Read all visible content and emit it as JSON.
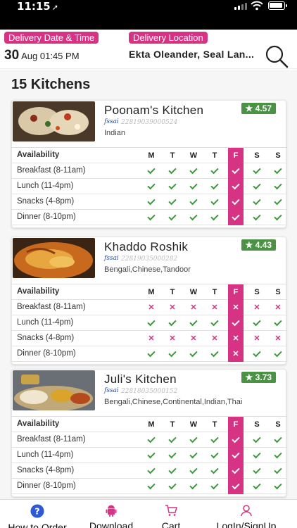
{
  "status": {
    "time": "11:15"
  },
  "header": {
    "date_chip": "Delivery Date & Time",
    "location_chip": "Delivery Location",
    "date_day": "30",
    "date_rest": "Aug 01:45 PM",
    "location": "Ekta Oleander, Seal Lan..."
  },
  "list": {
    "title": "15 Kitchens",
    "days": [
      "M",
      "T",
      "W",
      "T",
      "F",
      "S",
      "S"
    ],
    "today_index": 4,
    "availability_label": "Availability",
    "kitchens": [
      {
        "name": "Poonam's Kitchen",
        "rating": "4.57",
        "fssai_logo": "fssai",
        "fssai_no": "22819039000524",
        "cuisine": "Indian",
        "meals": [
          {
            "label": "Breakfast (8-11am)",
            "avail": [
              1,
              1,
              1,
              1,
              1,
              1,
              1
            ]
          },
          {
            "label": "Lunch (11-4pm)",
            "avail": [
              1,
              1,
              1,
              1,
              1,
              1,
              1
            ]
          },
          {
            "label": "Snacks (4-8pm)",
            "avail": [
              1,
              1,
              1,
              1,
              1,
              1,
              1
            ]
          },
          {
            "label": "Dinner (8-10pm)",
            "avail": [
              1,
              1,
              1,
              1,
              1,
              1,
              1
            ]
          }
        ]
      },
      {
        "name": "Khaddo Roshik",
        "rating": "4.43",
        "fssai_logo": "fssai",
        "fssai_no": "22819035000282",
        "cuisine": "Bengali,Chinese,Tandoor",
        "meals": [
          {
            "label": "Breakfast (8-11am)",
            "avail": [
              0,
              0,
              0,
              0,
              0,
              0,
              0
            ]
          },
          {
            "label": "Lunch (11-4pm)",
            "avail": [
              1,
              1,
              1,
              1,
              1,
              1,
              1
            ]
          },
          {
            "label": "Snacks (4-8pm)",
            "avail": [
              0,
              0,
              0,
              0,
              0,
              0,
              0
            ]
          },
          {
            "label": "Dinner (8-10pm)",
            "avail": [
              1,
              1,
              1,
              1,
              0,
              1,
              1
            ]
          }
        ]
      },
      {
        "name": "Juli's Kitchen",
        "rating": "3.73",
        "fssai_logo": "fssai",
        "fssai_no": "22818035000152",
        "cuisine": "Bengali,Chinese,Continental,Indian,Thai",
        "meals": [
          {
            "label": "Breakfast (8-11am)",
            "avail": [
              1,
              1,
              1,
              1,
              1,
              1,
              1
            ]
          },
          {
            "label": "Lunch (11-4pm)",
            "avail": [
              1,
              1,
              1,
              1,
              1,
              1,
              1
            ]
          },
          {
            "label": "Snacks (4-8pm)",
            "avail": [
              1,
              1,
              1,
              1,
              1,
              1,
              1
            ]
          },
          {
            "label": "Dinner (8-10pm)",
            "avail": [
              1,
              1,
              1,
              1,
              1,
              1,
              1
            ]
          }
        ]
      }
    ]
  },
  "nav": {
    "how_to_order": "How to Order",
    "download": "Download",
    "cart": "Cart",
    "login": "LogIn/SignUp"
  },
  "colors": {
    "accent": "#d63384",
    "check": "#3a9a3a",
    "rating": "#4b9245"
  }
}
